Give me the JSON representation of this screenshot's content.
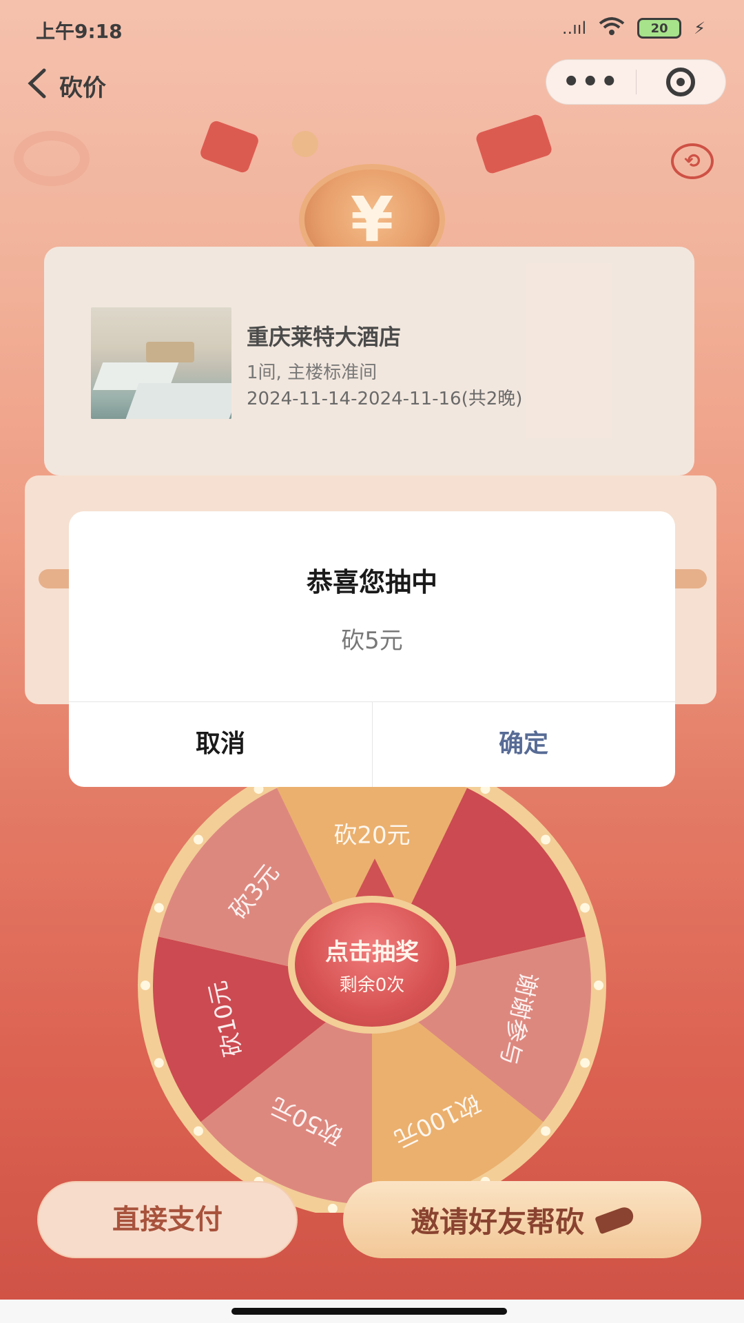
{
  "status_bar": {
    "time": "上午9:18",
    "signal_text": "..ııl",
    "battery": "20"
  },
  "nav": {
    "back_icon": "chevron-left-icon",
    "title": "砍价",
    "menu_dots": "•••"
  },
  "hotel": {
    "name": "重庆莱特大酒店",
    "room": "1间, 主楼标准间",
    "dates": "2024-11-14-2024-11-16(共2晚)"
  },
  "dialog": {
    "title": "恭喜您抽中",
    "message": "砍5元",
    "cancel_label": "取消",
    "confirm_label": "确定"
  },
  "wheel": {
    "segments": [
      {
        "label": "砍20元",
        "color": "#e9a55a"
      },
      {
        "label": "",
        "color": "#c5313a"
      },
      {
        "label": "谢谢参与",
        "color": "#d9786e"
      },
      {
        "label": "砍100元",
        "color": "#e9a55a"
      },
      {
        "label": "砍50元",
        "color": "#d9786e"
      },
      {
        "label": "砍10元",
        "color": "#c5313a"
      },
      {
        "label": "砍3元",
        "color": "#d9786e"
      }
    ],
    "spin_title": "点击抽奖",
    "spin_sub": "剩余0次"
  },
  "actions": {
    "pay_label": "直接支付",
    "invite_label": "邀请好友帮砍"
  },
  "colors": {
    "accent_red": "#c83a2c",
    "dialog_confirm": "#576b95",
    "wheel_rim": "#f2c889"
  }
}
